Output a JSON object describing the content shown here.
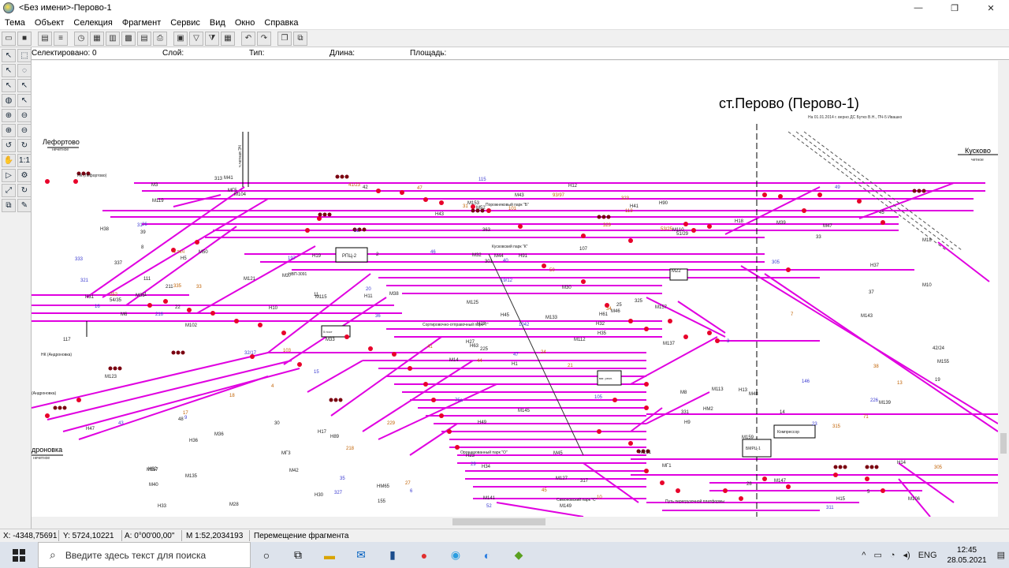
{
  "window": {
    "title": "<Без имени>-Перово-1",
    "minimize": "—",
    "maximize": "❐",
    "close": "✕"
  },
  "menu": [
    "Тема",
    "Объект",
    "Селекция",
    "Фрагмент",
    "Сервис",
    "Вид",
    "Окно",
    "Справка"
  ],
  "info": {
    "selected": "Селектировано: 0",
    "layer": "Слой:",
    "type": "Тип:",
    "length": "Длина:",
    "area": "Площадь:"
  },
  "map": {
    "title": "ст.Перово (Перово-1)",
    "subtitle": "На 01.01.2014 г. верно ДС Бутко В.Н., ПЧ-5 Ивашко",
    "left_station": "Лефортово",
    "left_station_sub": "нечетное",
    "right_station": "Кусково",
    "right_station_sub": "четное",
    "bottom_left_station": "дроновка",
    "bottom_left_sub": "нечетное",
    "nk_lefortovo": "НК (Лефортово)",
    "nk_andronovka": "НК (Андроновка)",
    "andronovka": "(Андроновка)",
    "rpc2": "РПЦ-2",
    "nvp": "НВП-3091",
    "parks": {
      "b": "Порожняковый парк \"Б\"",
      "k": "Кусковский парк \"К\"",
      "t": "Сортировочно-отправочный парк\"Т\"",
      "o": "Организованный парк \"О\"",
      "c": "Симоновский парк \"С\"",
      "platform": "Путь перегрузочной платформы"
    },
    "compressor": "Компрессор",
    "bmrc": "БМРЦ-1",
    "vag": "ваг. рекл.",
    "post5": "5 пост",
    "ch": "ч.четная ЭЧ",
    "depo": "4 ЭКЧ",
    "track_labels": [
      "Н1",
      "Н5",
      "Н63",
      "Н62",
      "Н61",
      "Н89",
      "Н90",
      "Н91",
      "М110",
      "М112",
      "М104",
      "М106",
      "М102",
      "М18",
      "М14",
      "М22",
      "М28",
      "М32",
      "М30",
      "М36",
      "М38",
      "М40",
      "М42",
      "М44",
      "М46",
      "М48",
      "М50",
      "М52",
      "М6",
      "М8",
      "М10",
      "Н27",
      "Н23",
      "Н22",
      "Н19",
      "Н18",
      "Н17",
      "Н15",
      "Н14",
      "Н13",
      "Н12",
      "Н11",
      "Н10",
      "Н9",
      "Н30",
      "Н31",
      "Н32",
      "Н33",
      "Н34",
      "Н35",
      "Н36",
      "Н37",
      "Н38",
      "НМ2",
      "МГ1",
      "МГ3",
      "МГ5",
      "М3",
      "М45",
      "М47",
      "М43",
      "М33",
      "М35",
      "М37",
      "М39",
      "М41",
      "Н41",
      "Н43",
      "Н45",
      "Н47",
      "Н49",
      "НМ65",
      "М113",
      "М115",
      "М117",
      "М119",
      "М121",
      "М123",
      "М125",
      "М127",
      "М133",
      "М135",
      "М137",
      "М139",
      "М141",
      "М143",
      "М145",
      "М147",
      "М149",
      "М151",
      "М153",
      "М155",
      "М157",
      "М159"
    ],
    "num_labels": [
      "1042",
      "71",
      "54/35",
      "52",
      "53/25",
      "51/29",
      "32/17",
      "41/23",
      "42/24",
      "16",
      "18",
      "30",
      "35",
      "34",
      "33",
      "36",
      "38",
      "39",
      "40",
      "41",
      "42",
      "43",
      "44",
      "45",
      "46",
      "47",
      "48",
      "49",
      "50",
      "2",
      "3",
      "4",
      "5",
      "6",
      "7",
      "8",
      "9",
      "10",
      "11",
      "12",
      "13",
      "14",
      "15",
      "17",
      "19",
      "20",
      "21",
      "22",
      "23",
      "24",
      "25",
      "26",
      "27",
      "28",
      "29",
      "31",
      "37",
      "197",
      "252",
      "155",
      "146",
      "93/97",
      "363",
      "19/12",
      "103",
      "107",
      "105",
      "101",
      "117",
      "115",
      "113",
      "111",
      "75a",
      "305",
      "313",
      "311",
      "315",
      "317",
      "321",
      "323",
      "325",
      "327",
      "329",
      "331",
      "333",
      "335",
      "337",
      "47",
      "45",
      "1",
      "31",
      "33",
      "211",
      "216",
      "218",
      "225",
      "226",
      "229",
      "301",
      "305"
    ]
  }
}
